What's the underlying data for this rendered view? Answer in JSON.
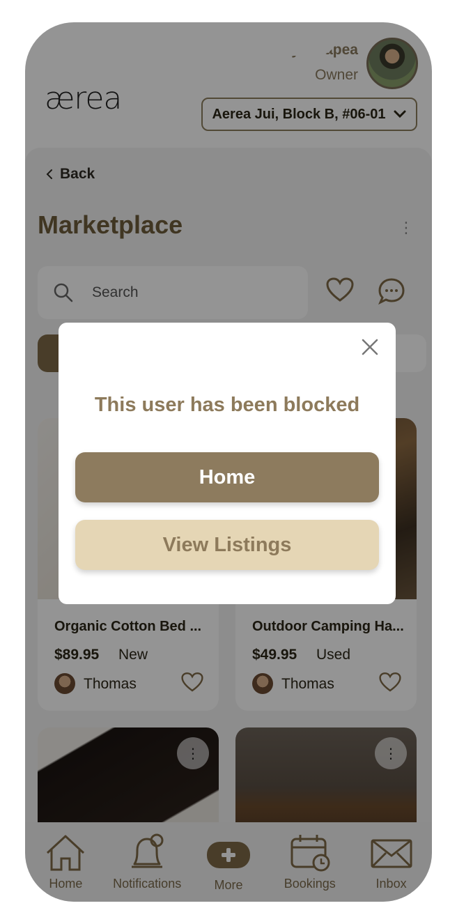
{
  "header": {
    "logo": "ærea",
    "user_name": "Sunny Mhapea",
    "user_role": "Owner",
    "unit": "Aerea Jui, Block B, #06-01"
  },
  "page": {
    "back_label": "Back",
    "title": "Marketplace",
    "search_placeholder": "Search"
  },
  "listings": [
    {
      "title": "Organic Cotton Bed ...",
      "price": "$89.95",
      "condition": "New",
      "seller": "Thomas"
    },
    {
      "title": "Outdoor Camping Ha...",
      "price": "$49.95",
      "condition": "Used",
      "seller": "Thomas"
    }
  ],
  "bottom_nav": {
    "home": "Home",
    "notifications": "Notifications",
    "more": "More",
    "bookings": "Bookings",
    "inbox": "Inbox"
  },
  "modal": {
    "message": "This user has been blocked",
    "home_button": "Home",
    "listings_button": "View Listings"
  },
  "colors": {
    "brand": "#7e6a47",
    "modal_primary": "#8d7b5e",
    "modal_secondary": "#e5d6b5",
    "modal_text": "#8d7a5b"
  }
}
